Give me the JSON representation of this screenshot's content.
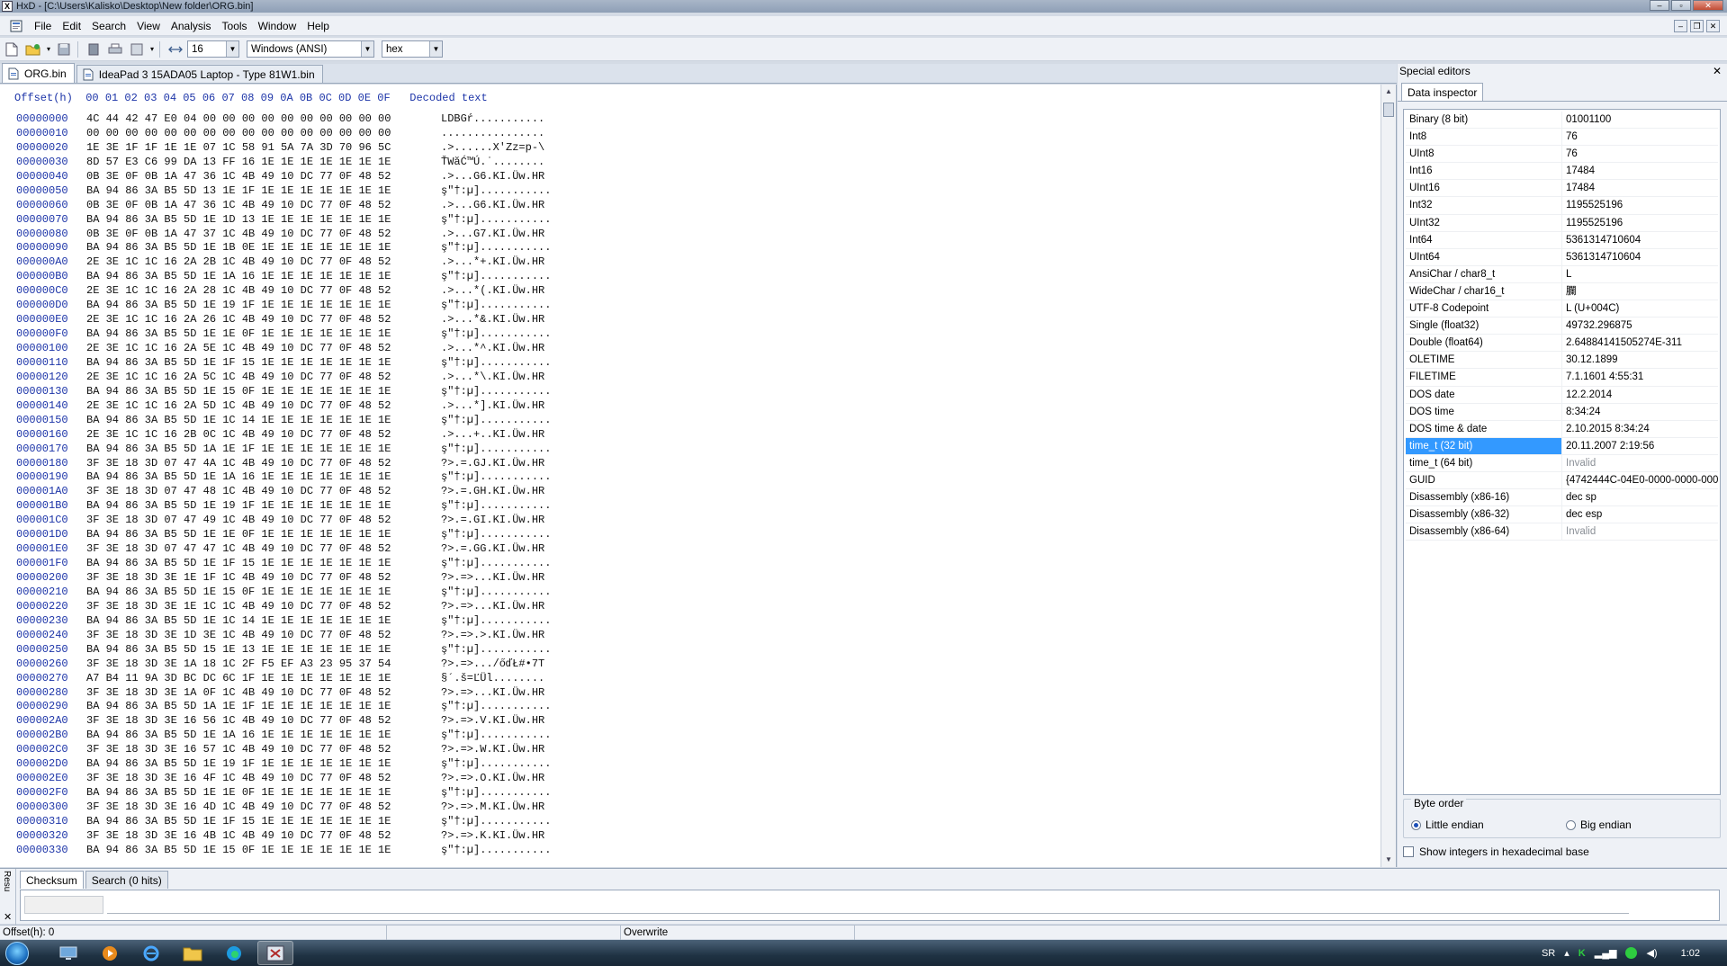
{
  "window": {
    "title": "HxD - [C:\\Users\\Kalisko\\Desktop\\New folder\\ORG.bin]",
    "controls": {
      "minimize": "–",
      "maximize": "▫",
      "close": "✕"
    }
  },
  "menu": {
    "items": [
      "File",
      "Edit",
      "Search",
      "View",
      "Analysis",
      "Tools",
      "Window",
      "Help"
    ],
    "mdi_controls": {
      "minimize": "–",
      "restore": "❐",
      "close": "✕"
    }
  },
  "toolbar": {
    "bytes_per_row": "16",
    "charset": "Windows (ANSI)",
    "offset_base": "hex"
  },
  "doc_tabs": [
    {
      "label": "ORG.bin",
      "active": true
    },
    {
      "label": "IdeaPad 3 15ADA05 Laptop - Type 81W1.bin",
      "active": false
    }
  ],
  "hex": {
    "header": "Offset(h)  00 01 02 03 04 05 06 07 08 09 0A 0B 0C 0D 0E 0F   Decoded text",
    "rows": [
      {
        "offset": "00000000",
        "bytes": "4C 44 42 47 E0 04 00 00 00 00 00 00 00 00 00 00",
        "decoded": "LDBGŕ..........."
      },
      {
        "offset": "00000010",
        "bytes": "00 00 00 00 00 00 00 00 00 00 00 00 00 00 00 00",
        "decoded": "................"
      },
      {
        "offset": "00000020",
        "bytes": "1E 3E 1F 1F 1E 1E 07 1C 58 91 5A 7A 3D 70 96 5C",
        "decoded": ".>......X'Zz=p-\\"
      },
      {
        "offset": "00000030",
        "bytes": "8D 57 E3 C6 99 DA 13 FF 16 1E 1E 1E 1E 1E 1E 1E",
        "decoded": "ŤWăĆ™Ú.˙........"
      },
      {
        "offset": "00000040",
        "bytes": "0B 3E 0F 0B 1A 47 36 1C 4B 49 10 DC 77 0F 48 52",
        "decoded": ".>...G6.KI.Üw.HR"
      },
      {
        "offset": "00000050",
        "bytes": "BA 94 86 3A B5 5D 13 1E 1F 1E 1E 1E 1E 1E 1E 1E",
        "decoded": "ş\"†:µ]..........."
      },
      {
        "offset": "00000060",
        "bytes": "0B 3E 0F 0B 1A 47 36 1C 4B 49 10 DC 77 0F 48 52",
        "decoded": ".>...G6.KI.Üw.HR"
      },
      {
        "offset": "00000070",
        "bytes": "BA 94 86 3A B5 5D 1E 1D 13 1E 1E 1E 1E 1E 1E 1E",
        "decoded": "ş\"†:µ]..........."
      },
      {
        "offset": "00000080",
        "bytes": "0B 3E 0F 0B 1A 47 37 1C 4B 49 10 DC 77 0F 48 52",
        "decoded": ".>...G7.KI.Üw.HR"
      },
      {
        "offset": "00000090",
        "bytes": "BA 94 86 3A B5 5D 1E 1B 0E 1E 1E 1E 1E 1E 1E 1E",
        "decoded": "ş\"†:µ]..........."
      },
      {
        "offset": "000000A0",
        "bytes": "2E 3E 1C 1C 16 2A 2B 1C 4B 49 10 DC 77 0F 48 52",
        "decoded": ".>...*+.KI.Üw.HR"
      },
      {
        "offset": "000000B0",
        "bytes": "BA 94 86 3A B5 5D 1E 1A 16 1E 1E 1E 1E 1E 1E 1E",
        "decoded": "ş\"†:µ]..........."
      },
      {
        "offset": "000000C0",
        "bytes": "2E 3E 1C 1C 16 2A 28 1C 4B 49 10 DC 77 0F 48 52",
        "decoded": ".>...*(.KI.Üw.HR"
      },
      {
        "offset": "000000D0",
        "bytes": "BA 94 86 3A B5 5D 1E 19 1F 1E 1E 1E 1E 1E 1E 1E",
        "decoded": "ş\"†:µ]..........."
      },
      {
        "offset": "000000E0",
        "bytes": "2E 3E 1C 1C 16 2A 26 1C 4B 49 10 DC 77 0F 48 52",
        "decoded": ".>...*&.KI.Üw.HR"
      },
      {
        "offset": "000000F0",
        "bytes": "BA 94 86 3A B5 5D 1E 1E 0F 1E 1E 1E 1E 1E 1E 1E",
        "decoded": "ş\"†:µ]..........."
      },
      {
        "offset": "00000100",
        "bytes": "2E 3E 1C 1C 16 2A 5E 1C 4B 49 10 DC 77 0F 48 52",
        "decoded": ".>...*^.KI.Üw.HR"
      },
      {
        "offset": "00000110",
        "bytes": "BA 94 86 3A B5 5D 1E 1F 15 1E 1E 1E 1E 1E 1E 1E",
        "decoded": "ş\"†:µ]..........."
      },
      {
        "offset": "00000120",
        "bytes": "2E 3E 1C 1C 16 2A 5C 1C 4B 49 10 DC 77 0F 48 52",
        "decoded": ".>...*\\.KI.Üw.HR"
      },
      {
        "offset": "00000130",
        "bytes": "BA 94 86 3A B5 5D 1E 15 0F 1E 1E 1E 1E 1E 1E 1E",
        "decoded": "ş\"†:µ]..........."
      },
      {
        "offset": "00000140",
        "bytes": "2E 3E 1C 1C 16 2A 5D 1C 4B 49 10 DC 77 0F 48 52",
        "decoded": ".>...*].KI.Üw.HR"
      },
      {
        "offset": "00000150",
        "bytes": "BA 94 86 3A B5 5D 1E 1C 14 1E 1E 1E 1E 1E 1E 1E",
        "decoded": "ş\"†:µ]..........."
      },
      {
        "offset": "00000160",
        "bytes": "2E 3E 1C 1C 16 2B 0C 1C 4B 49 10 DC 77 0F 48 52",
        "decoded": ".>...+..KI.Üw.HR"
      },
      {
        "offset": "00000170",
        "bytes": "BA 94 86 3A B5 5D 1A 1E 1F 1E 1E 1E 1E 1E 1E 1E",
        "decoded": "ş\"†:µ]..........."
      },
      {
        "offset": "00000180",
        "bytes": "3F 3E 18 3D 07 47 4A 1C 4B 49 10 DC 77 0F 48 52",
        "decoded": "?>.=.GJ.KI.Üw.HR"
      },
      {
        "offset": "00000190",
        "bytes": "BA 94 86 3A B5 5D 1E 1A 16 1E 1E 1E 1E 1E 1E 1E",
        "decoded": "ş\"†:µ]..........."
      },
      {
        "offset": "000001A0",
        "bytes": "3F 3E 18 3D 07 47 48 1C 4B 49 10 DC 77 0F 48 52",
        "decoded": "?>.=.GH.KI.Üw.HR"
      },
      {
        "offset": "000001B0",
        "bytes": "BA 94 86 3A B5 5D 1E 19 1F 1E 1E 1E 1E 1E 1E 1E",
        "decoded": "ş\"†:µ]..........."
      },
      {
        "offset": "000001C0",
        "bytes": "3F 3E 18 3D 07 47 49 1C 4B 49 10 DC 77 0F 48 52",
        "decoded": "?>.=.GI.KI.Üw.HR"
      },
      {
        "offset": "000001D0",
        "bytes": "BA 94 86 3A B5 5D 1E 1E 0F 1E 1E 1E 1E 1E 1E 1E",
        "decoded": "ş\"†:µ]..........."
      },
      {
        "offset": "000001E0",
        "bytes": "3F 3E 18 3D 07 47 47 1C 4B 49 10 DC 77 0F 48 52",
        "decoded": "?>.=.GG.KI.Üw.HR"
      },
      {
        "offset": "000001F0",
        "bytes": "BA 94 86 3A B5 5D 1E 1F 15 1E 1E 1E 1E 1E 1E 1E",
        "decoded": "ş\"†:µ]..........."
      },
      {
        "offset": "00000200",
        "bytes": "3F 3E 18 3D 3E 1E 1F 1C 4B 49 10 DC 77 0F 48 52",
        "decoded": "?>.=>...KI.Üw.HR"
      },
      {
        "offset": "00000210",
        "bytes": "BA 94 86 3A B5 5D 1E 15 0F 1E 1E 1E 1E 1E 1E 1E",
        "decoded": "ş\"†:µ]..........."
      },
      {
        "offset": "00000220",
        "bytes": "3F 3E 18 3D 3E 1E 1C 1C 4B 49 10 DC 77 0F 48 52",
        "decoded": "?>.=>...KI.Üw.HR"
      },
      {
        "offset": "00000230",
        "bytes": "BA 94 86 3A B5 5D 1E 1C 14 1E 1E 1E 1E 1E 1E 1E",
        "decoded": "ş\"†:µ]..........."
      },
      {
        "offset": "00000240",
        "bytes": "3F 3E 18 3D 3E 1D 3E 1C 4B 49 10 DC 77 0F 48 52",
        "decoded": "?>.=>.>.KI.Üw.HR"
      },
      {
        "offset": "00000250",
        "bytes": "BA 94 86 3A B5 5D 15 1E 13 1E 1E 1E 1E 1E 1E 1E",
        "decoded": "ş\"†:µ]..........."
      },
      {
        "offset": "00000260",
        "bytes": "3F 3E 18 3D 3E 1A 18 1C 2F F5 EF A3 23 95 37 54",
        "decoded": "?>.=>.../őďŁ#•7T"
      },
      {
        "offset": "00000270",
        "bytes": "A7 B4 11 9A 3D BC DC 6C 1F 1E 1E 1E 1E 1E 1E 1E",
        "decoded": "§´.š=ĽÜl........"
      },
      {
        "offset": "00000280",
        "bytes": "3F 3E 18 3D 3E 1A 0F 1C 4B 49 10 DC 77 0F 48 52",
        "decoded": "?>.=>...KI.Üw.HR"
      },
      {
        "offset": "00000290",
        "bytes": "BA 94 86 3A B5 5D 1A 1E 1F 1E 1E 1E 1E 1E 1E 1E",
        "decoded": "ş\"†:µ]..........."
      },
      {
        "offset": "000002A0",
        "bytes": "3F 3E 18 3D 3E 16 56 1C 4B 49 10 DC 77 0F 48 52",
        "decoded": "?>.=>.V.KI.Üw.HR"
      },
      {
        "offset": "000002B0",
        "bytes": "BA 94 86 3A B5 5D 1E 1A 16 1E 1E 1E 1E 1E 1E 1E",
        "decoded": "ş\"†:µ]..........."
      },
      {
        "offset": "000002C0",
        "bytes": "3F 3E 18 3D 3E 16 57 1C 4B 49 10 DC 77 0F 48 52",
        "decoded": "?>.=>.W.KI.Üw.HR"
      },
      {
        "offset": "000002D0",
        "bytes": "BA 94 86 3A B5 5D 1E 19 1F 1E 1E 1E 1E 1E 1E 1E",
        "decoded": "ş\"†:µ]..........."
      },
      {
        "offset": "000002E0",
        "bytes": "3F 3E 18 3D 3E 16 4F 1C 4B 49 10 DC 77 0F 48 52",
        "decoded": "?>.=>.O.KI.Üw.HR"
      },
      {
        "offset": "000002F0",
        "bytes": "BA 94 86 3A B5 5D 1E 1E 0F 1E 1E 1E 1E 1E 1E 1E",
        "decoded": "ş\"†:µ]..........."
      },
      {
        "offset": "00000300",
        "bytes": "3F 3E 18 3D 3E 16 4D 1C 4B 49 10 DC 77 0F 48 52",
        "decoded": "?>.=>.M.KI.Üw.HR"
      },
      {
        "offset": "00000310",
        "bytes": "BA 94 86 3A B5 5D 1E 1F 15 1E 1E 1E 1E 1E 1E 1E",
        "decoded": "ş\"†:µ]..........."
      },
      {
        "offset": "00000320",
        "bytes": "3F 3E 18 3D 3E 16 4B 1C 4B 49 10 DC 77 0F 48 52",
        "decoded": "?>.=>.K.KI.Üw.HR"
      },
      {
        "offset": "00000330",
        "bytes": "BA 94 86 3A B5 5D 1E 15 0F 1E 1E 1E 1E 1E 1E 1E",
        "decoded": "ş\"†:µ]..........."
      }
    ]
  },
  "special_editors": {
    "title": "Special editors",
    "close": "✕",
    "tab": "Data inspector",
    "rows": [
      {
        "label": "Binary (8 bit)",
        "value": "01001100"
      },
      {
        "label": "Int8",
        "value": "76"
      },
      {
        "label": "UInt8",
        "value": "76"
      },
      {
        "label": "Int16",
        "value": "17484"
      },
      {
        "label": "UInt16",
        "value": "17484"
      },
      {
        "label": "Int32",
        "value": "1195525196"
      },
      {
        "label": "UInt32",
        "value": "1195525196"
      },
      {
        "label": "Int64",
        "value": "5361314710604"
      },
      {
        "label": "UInt64",
        "value": "5361314710604"
      },
      {
        "label": "AnsiChar / char8_t",
        "value": "L"
      },
      {
        "label": "WideChar / char16_t",
        "value": "䑌"
      },
      {
        "label": "UTF-8 Codepoint",
        "value": "L (U+004C)"
      },
      {
        "label": "Single (float32)",
        "value": "49732.296875"
      },
      {
        "label": "Double (float64)",
        "value": "2.64884141505274E-311"
      },
      {
        "label": "OLETIME",
        "value": "30.12.1899"
      },
      {
        "label": "FILETIME",
        "value": "7.1.1601 4:55:31"
      },
      {
        "label": "DOS date",
        "value": "12.2.2014"
      },
      {
        "label": "DOS time",
        "value": "8:34:24"
      },
      {
        "label": "DOS time & date",
        "value": "2.10.2015 8:34:24"
      },
      {
        "label": "time_t (32 bit)",
        "value": "20.11.2007 2:19:56"
      },
      {
        "label": "time_t (64 bit)",
        "value": "Invalid"
      },
      {
        "label": "GUID",
        "value": "{4742444C-04E0-0000-0000-0000"
      },
      {
        "label": "Disassembly (x86-16)",
        "value": "dec sp"
      },
      {
        "label": "Disassembly (x86-32)",
        "value": "dec esp"
      },
      {
        "label": "Disassembly (x86-64)",
        "value": "Invalid"
      }
    ],
    "byte_order": {
      "legend": "Byte order",
      "little": "Little endian",
      "big": "Big endian"
    },
    "hex_checkbox": "Show integers in hexadecimal base"
  },
  "results": {
    "side_label": "Resu",
    "close": "✕",
    "tabs": [
      "Checksum",
      "Search (0 hits)"
    ]
  },
  "status": {
    "offset": "Offset(h): 0",
    "mode": "Overwrite"
  },
  "taskbar": {
    "lang": "SR",
    "clock": "1:02"
  }
}
